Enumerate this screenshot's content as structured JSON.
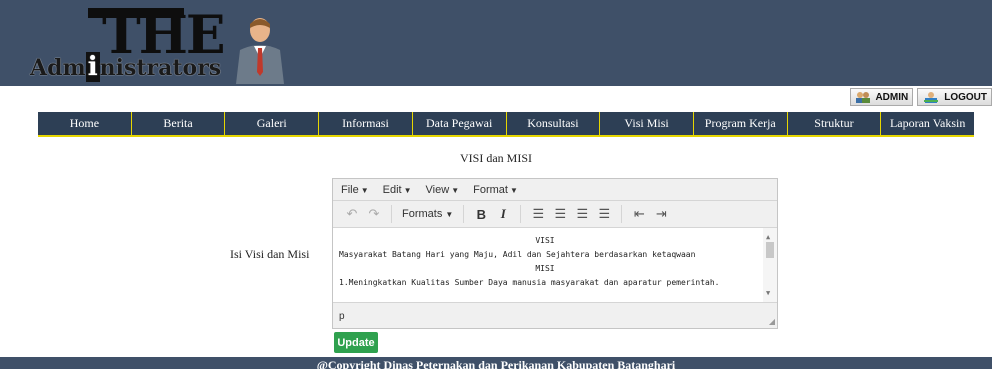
{
  "header": {
    "logo_text": "Adm",
    "logo_text_i": "i",
    "logo_text_rest": "nistrators",
    "logo_the": "THE"
  },
  "userbar": {
    "admin_label": "ADMIN",
    "logout_label": "LOGOUT"
  },
  "nav": {
    "items": [
      "Home",
      "Berita",
      "Galeri",
      "Informasi",
      "Data Pegawai",
      "Konsultasi",
      "Visi Misi",
      "Program Kerja",
      "Struktur",
      "Laporan Vaksin"
    ]
  },
  "page": {
    "section_title": "VISI dan MISI",
    "field_label": "Isi Visi dan Misi"
  },
  "editor": {
    "menu": [
      "File",
      "Edit",
      "View",
      "Format"
    ],
    "formats_label": "Formats",
    "content_lines": [
      "VISI",
      "Masyarakat Batang Hari yang Maju, Adil dan Sejahtera berdasarkan ketaqwaan",
      "MISI",
      "1.Meningkatkan  Kualitas Sumber Daya manusia masyarakat dan aparatur pemerintah."
    ],
    "status_path": "p"
  },
  "actions": {
    "update_label": "Update"
  },
  "footer": {
    "text": "@Copyright Dinas Peternakan dan Perikanan Kabupaten Batanghari"
  },
  "colors": {
    "header_bg": "#3f5068",
    "nav_bg": "#2d3f55",
    "nav_accent": "#e6d600",
    "update_button": "#2fa14e"
  }
}
